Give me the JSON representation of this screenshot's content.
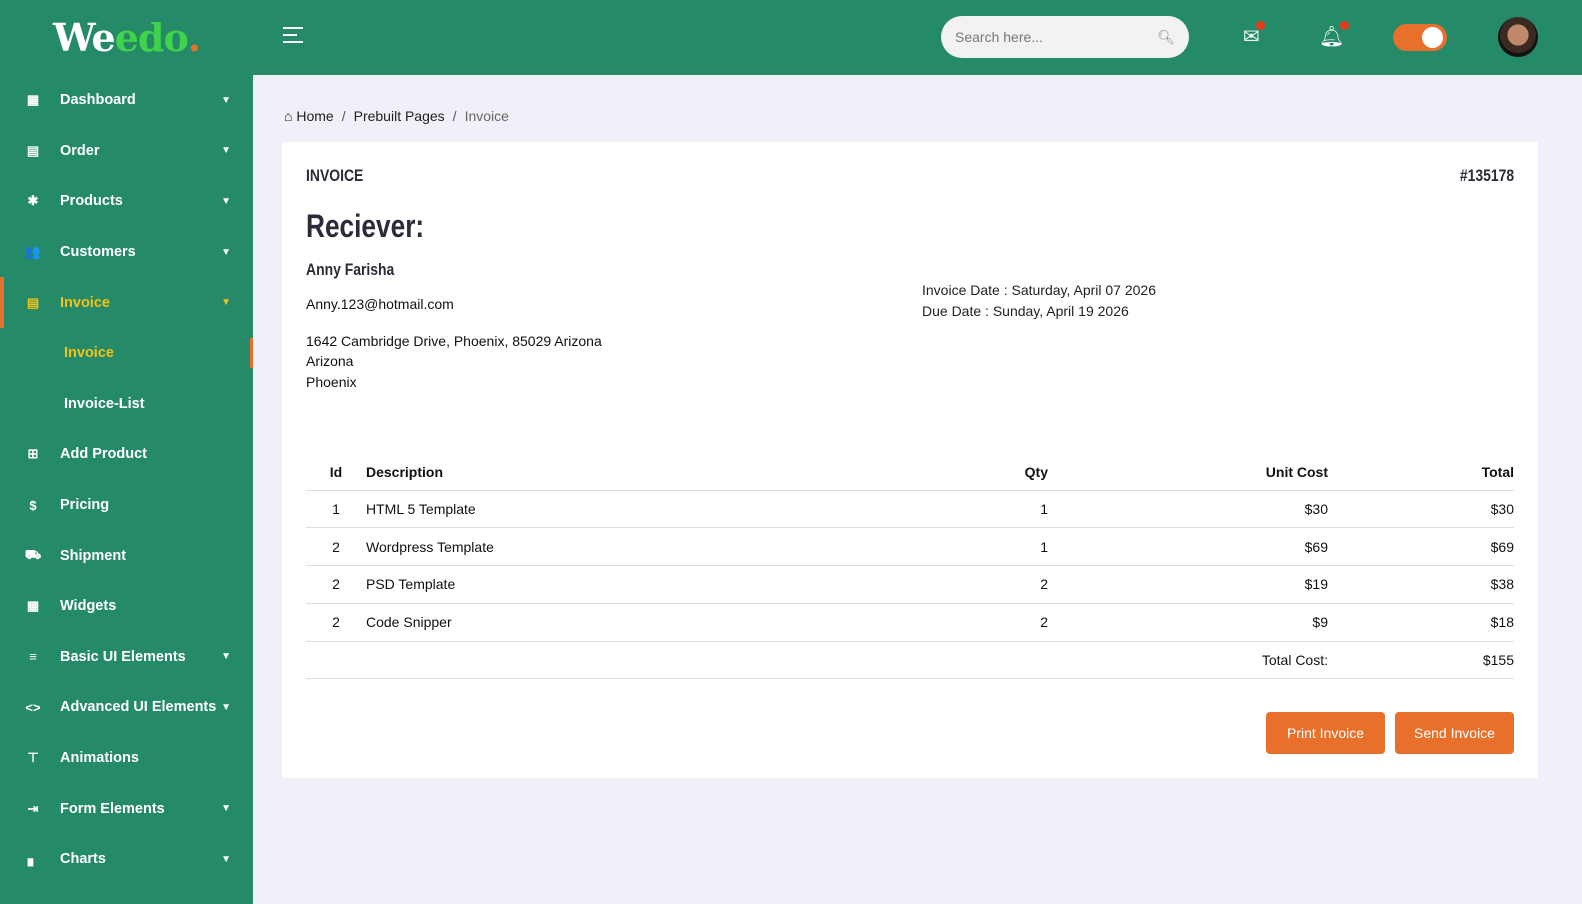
{
  "logo": {
    "part1": "We",
    "part2": "edo",
    "part3": "."
  },
  "sidebar": {
    "items": [
      {
        "label": "Dashboard",
        "icon": "▦"
      },
      {
        "label": "Order",
        "icon": "▤"
      },
      {
        "label": "Products",
        "icon": "✱"
      },
      {
        "label": "Customers",
        "icon": "👥"
      },
      {
        "label": "Invoice",
        "icon": "▤"
      },
      {
        "label": "Invoice"
      },
      {
        "label": "Invoice-List"
      },
      {
        "label": "Add Product",
        "icon": "⊞"
      },
      {
        "label": "Pricing",
        "icon": "$"
      },
      {
        "label": "Shipment",
        "icon": "⛟"
      },
      {
        "label": "Widgets",
        "icon": "▦"
      },
      {
        "label": "Basic UI Elements",
        "icon": "≡"
      },
      {
        "label": "Advanced UI Elements",
        "icon": "<>"
      },
      {
        "label": "Animations",
        "icon": "⊤"
      },
      {
        "label": "Form Elements",
        "icon": "⇥"
      },
      {
        "label": "Charts",
        "icon": "▖"
      }
    ]
  },
  "topbar": {
    "search_placeholder": "Search here..."
  },
  "breadcrumb": {
    "home": "Home",
    "mid": "Prebuilt Pages",
    "current": "Invoice"
  },
  "invoice": {
    "title": "INVOICE",
    "number": "#135178",
    "receiver_label": "Reciever:",
    "name": "Anny Farisha",
    "email": "Anny.123@hotmail.com",
    "address1": "1642 Cambridge Drive, Phoenix, 85029 Arizona",
    "address2": "Arizona",
    "address3": "Phoenix",
    "invoice_date": "Invoice Date : Saturday, April 07 2026",
    "due_date": "Due Date : Sunday, April 19 2026"
  },
  "table": {
    "headers": [
      "Id",
      "Description",
      "Qty",
      "Unit Cost",
      "Total"
    ],
    "rows": [
      [
        "1",
        "HTML 5 Template",
        "1",
        "$30",
        "$30"
      ],
      [
        "2",
        "Wordpress Template",
        "1",
        "$69",
        "$69"
      ],
      [
        "2",
        "PSD Template",
        "2",
        "$19",
        "$38"
      ],
      [
        "2",
        "Code Snipper",
        "2",
        "$9",
        "$18"
      ]
    ],
    "total_label": "Total Cost:",
    "total_value": "$155"
  },
  "buttons": {
    "print": "Print Invoice",
    "send": "Send Invoice"
  }
}
